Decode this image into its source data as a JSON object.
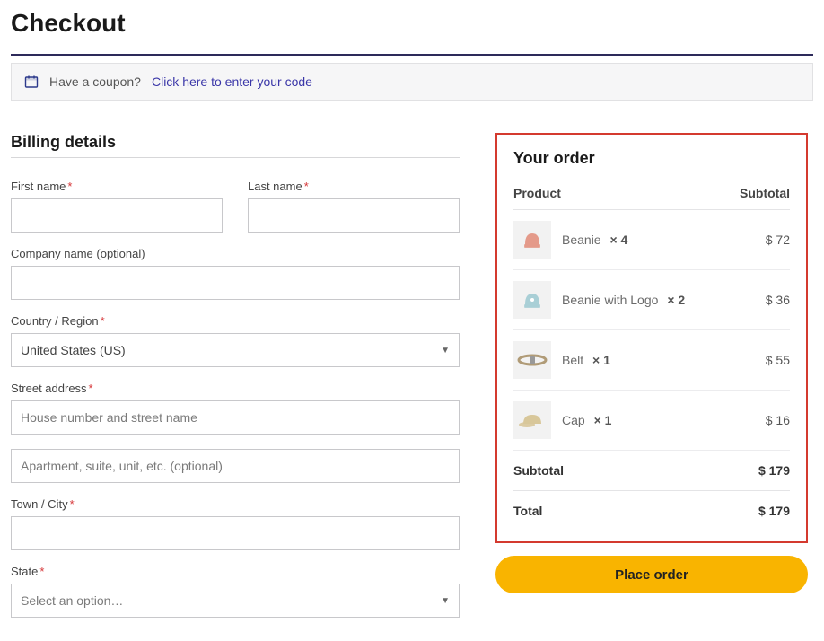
{
  "page_title": "Checkout",
  "coupon": {
    "prompt": "Have a coupon?",
    "link_text": "Click here to enter your code"
  },
  "billing": {
    "heading": "Billing details",
    "first_name_label": "First name",
    "last_name_label": "Last name",
    "company_label": "Company name (optional)",
    "country_label": "Country / Region",
    "country_value": "United States (US)",
    "street_label": "Street address",
    "street1_placeholder": "House number and street name",
    "street2_placeholder": "Apartment, suite, unit, etc. (optional)",
    "town_label": "Town / City",
    "state_label": "State",
    "state_placeholder": "Select an option…"
  },
  "order": {
    "heading": "Your order",
    "col_product": "Product",
    "col_subtotal": "Subtotal",
    "items": [
      {
        "name": "Beanie",
        "qty": "× 4",
        "subtotal": "$ 72",
        "thumb_bg": "#f2f2f2",
        "thumb_color": "#e49a8a"
      },
      {
        "name": "Beanie with Logo",
        "qty": "× 2",
        "subtotal": "$ 36",
        "thumb_bg": "#f2f2f2",
        "thumb_color": "#a9cfd6"
      },
      {
        "name": "Belt",
        "qty": "× 1",
        "subtotal": "$ 55",
        "thumb_bg": "#f2f2f2",
        "thumb_color": "#b09b77"
      },
      {
        "name": "Cap",
        "qty": "× 1",
        "subtotal": "$ 16",
        "thumb_bg": "#f2f2f2",
        "thumb_color": "#d8c79a"
      }
    ],
    "subtotal_label": "Subtotal",
    "subtotal_value": "$ 179",
    "total_label": "Total",
    "total_value": "$ 179",
    "place_order_label": "Place order"
  }
}
